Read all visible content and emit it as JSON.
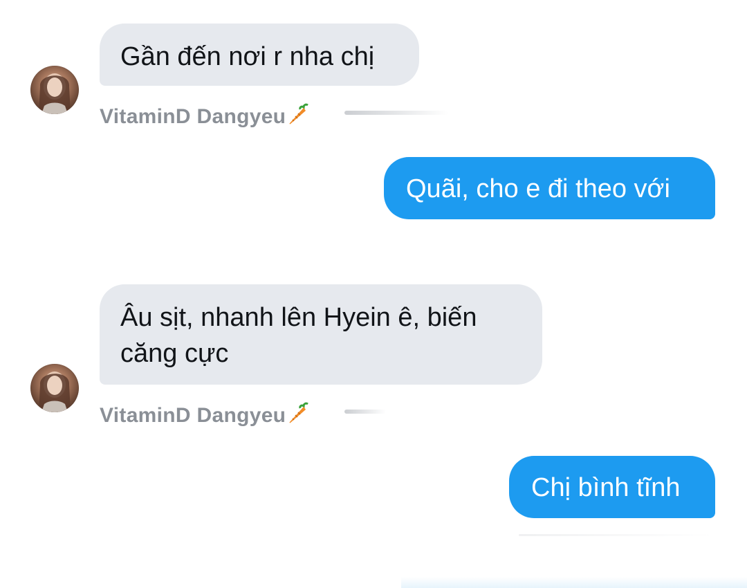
{
  "conversation": {
    "messages": [
      {
        "direction": "incoming",
        "text": "Gần đến nơi r nha chị",
        "sender": "VitaminD Dangyeu"
      },
      {
        "direction": "outgoing",
        "text": "Quãi, cho e đi theo với"
      },
      {
        "direction": "incoming",
        "text": "Âu sịt, nhanh lên Hyein ê, biến\ncăng cực",
        "sender": "VitaminD Dangyeu"
      },
      {
        "direction": "outgoing",
        "text": "Chị bình tĩnh"
      }
    ]
  },
  "colors": {
    "incoming_bubble": "#e6e9ee",
    "outgoing_bubble": "#1d9bf0",
    "sender_text": "#8a8f96"
  },
  "icons": {
    "sender_emoji": "carrot-icon"
  }
}
